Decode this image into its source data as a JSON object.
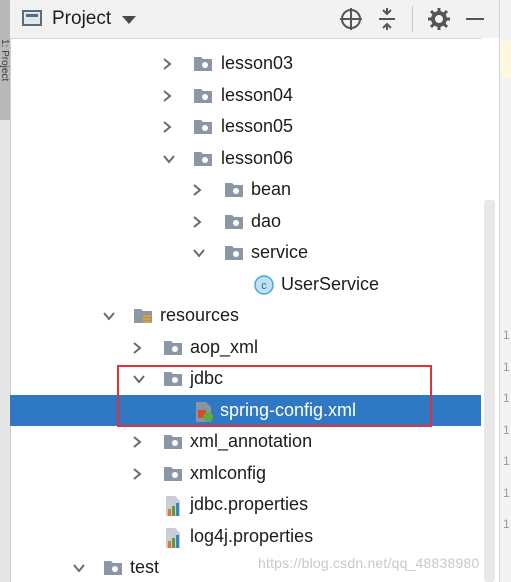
{
  "window": {
    "left_tab": "1: Project",
    "panel_title": "Project"
  },
  "toolbar": {
    "icons": [
      "crosshair-icon",
      "collapse-icon",
      "gear-icon",
      "minimize-icon"
    ]
  },
  "tree": {
    "items": [
      {
        "label": "lesson03",
        "type": "folder",
        "expanded": false
      },
      {
        "label": "lesson04",
        "type": "folder",
        "expanded": false
      },
      {
        "label": "lesson05",
        "type": "folder",
        "expanded": false
      },
      {
        "label": "lesson06",
        "type": "folder",
        "expanded": true
      },
      {
        "label": "bean",
        "type": "folder",
        "expanded": false
      },
      {
        "label": "dao",
        "type": "folder",
        "expanded": false
      },
      {
        "label": "service",
        "type": "folder",
        "expanded": true
      },
      {
        "label": "UserService",
        "type": "class"
      },
      {
        "label": "resources",
        "type": "resources-folder",
        "expanded": true
      },
      {
        "label": "aop_xml",
        "type": "folder",
        "expanded": false
      },
      {
        "label": "jdbc",
        "type": "folder",
        "expanded": true
      },
      {
        "label": "spring-config.xml",
        "type": "spring-xml",
        "selected": true
      },
      {
        "label": "xml_annotation",
        "type": "folder",
        "expanded": false
      },
      {
        "label": "xmlconfig",
        "type": "folder",
        "expanded": false
      },
      {
        "label": "jdbc.properties",
        "type": "properties"
      },
      {
        "label": "log4j.properties",
        "type": "properties"
      },
      {
        "label": "test",
        "type": "folder",
        "expanded": true
      }
    ]
  },
  "gutter": {
    "numbers": [
      "1",
      "1",
      "1",
      "1",
      "1",
      "1",
      "1"
    ]
  },
  "watermark": "https://blog.csdn.net/qq_48838980",
  "colors": {
    "selection": "#2f78c4",
    "highlight_border": "#e0323b",
    "folder": "#8a97a6",
    "class_icon": "#3fa9d6"
  }
}
